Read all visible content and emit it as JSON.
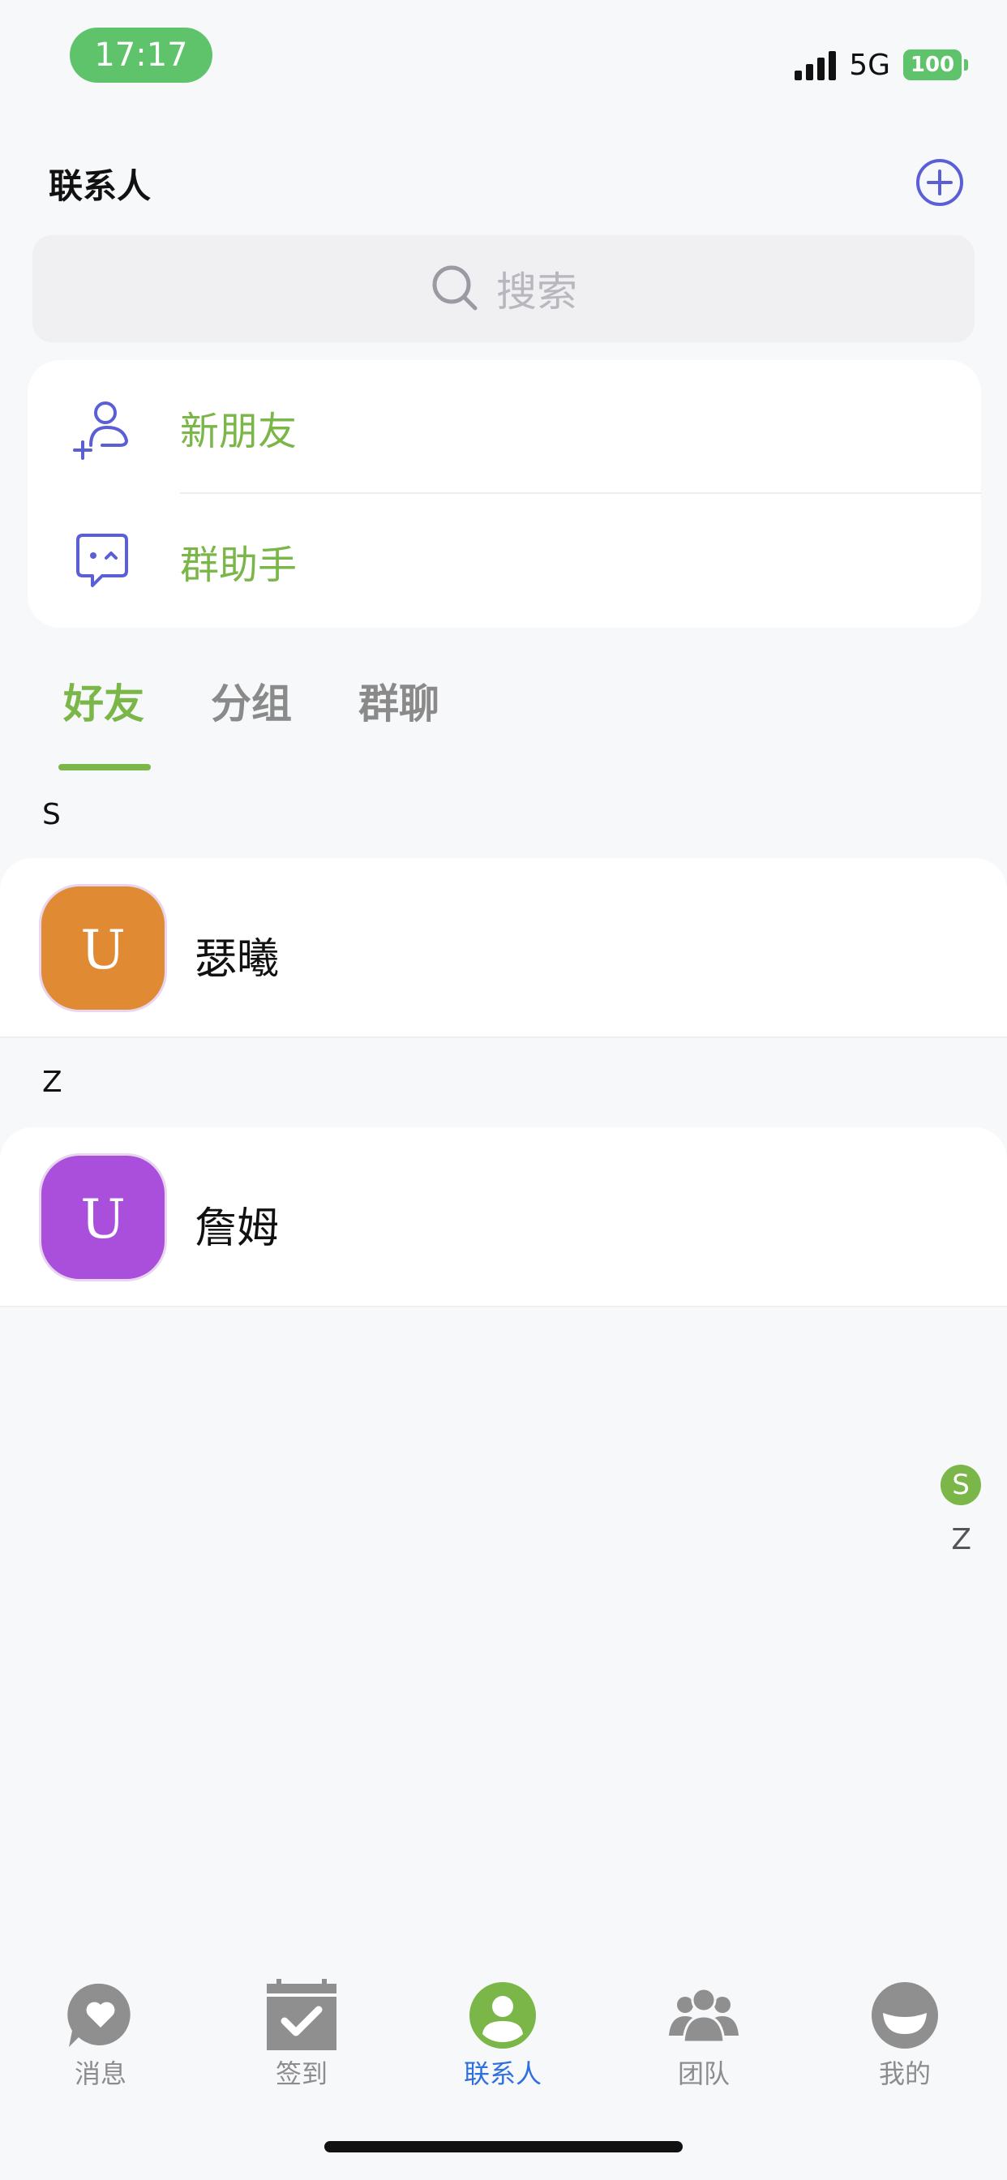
{
  "status_bar": {
    "time": "17:17",
    "network": "5G",
    "battery": "100"
  },
  "header": {
    "title": "联系人"
  },
  "search": {
    "placeholder": "搜索"
  },
  "quick_entries": [
    {
      "label": "新朋友",
      "icon": "add-person-icon"
    },
    {
      "label": "群助手",
      "icon": "group-assistant-icon"
    }
  ],
  "tabs": [
    {
      "label": "好友",
      "active": true
    },
    {
      "label": "分组",
      "active": false
    },
    {
      "label": "群聊",
      "active": false
    }
  ],
  "sections": [
    {
      "letter": "S",
      "contacts": [
        {
          "name": "瑟曦",
          "avatar_text": "U",
          "avatar_color": "#e08a34"
        }
      ]
    },
    {
      "letter": "Z",
      "contacts": [
        {
          "name": "詹姆",
          "avatar_text": "U",
          "avatar_color": "#a94fdc"
        }
      ]
    }
  ],
  "index_bar": {
    "letters": [
      "S",
      "Z"
    ],
    "active": "S"
  },
  "bottom_nav": [
    {
      "label": "消息",
      "icon": "message-heart-icon",
      "active": false
    },
    {
      "label": "签到",
      "icon": "check-in-calendar-icon",
      "active": false
    },
    {
      "label": "联系人",
      "icon": "contacts-icon",
      "active": true
    },
    {
      "label": "团队",
      "icon": "team-icon",
      "active": false
    },
    {
      "label": "我的",
      "icon": "profile-icon",
      "active": false
    }
  ],
  "colors": {
    "accent_green": "#7ab648",
    "nav_active_blue": "#2f6fde",
    "icon_purple": "#5a5fd6",
    "status_green": "#5ec36a"
  }
}
